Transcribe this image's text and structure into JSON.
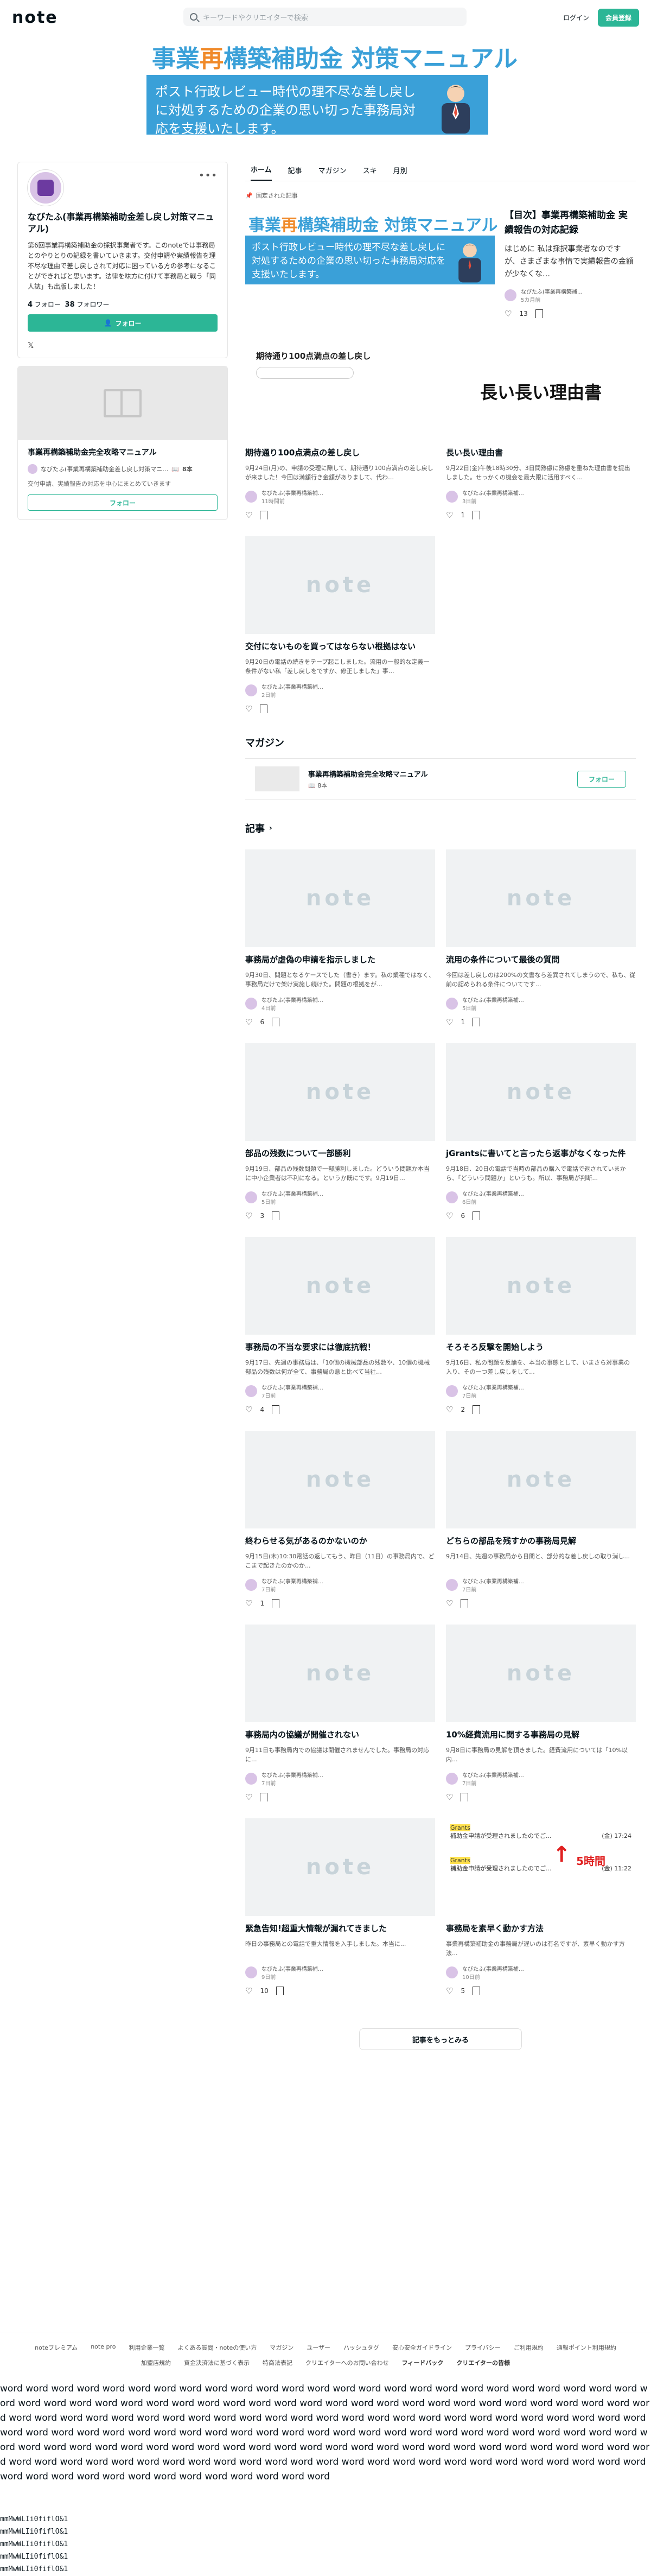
{
  "header": {
    "logo": "note",
    "search_placeholder": "キーワードやクリエイターで検索",
    "login": "ログイン",
    "signup": "会員登録"
  },
  "banner": {
    "title_a": "事業",
    "title_b": "再",
    "title_c": "構築補助金 対策マニュアル",
    "body": "ポスト行政レビュー時代の理不尽な差し戻しに対処するための企業の思い切った事務局対応を支援いたします。"
  },
  "profile": {
    "name": "なびたふ(事業再構築補助金差し戻し対策マニュアル)",
    "description": "第6回事業再構築補助金の採択事業者です。このnoteでは事務局とのやりとりの記録を書いていきます。交付申請や実績報告を理不尽な理由で差し戻しされて対応に困っている方の参考になることができればと思います。法律を味方に付けて事務局と戦う「同人誌」も出版しました！",
    "follow_count": "4",
    "follow_label": "フォロー",
    "follower_count": "38",
    "follower_label": "フォロワー",
    "follow_button": "フォロー"
  },
  "side_magazine": {
    "title": "事業再構築補助金完全攻略マニュアル",
    "author": "なびたふ(事業再構築補助金差し戻し対策マニ…",
    "count": "8本",
    "desc": "交付申請、実績報告の対応を中心にまとめていきます",
    "follow": "フォロー"
  },
  "tabs": [
    "ホーム",
    "記事",
    "マガジン",
    "スキ",
    "月別"
  ],
  "pinned_label": "固定された記事",
  "featured": {
    "thumb_title_a": "事業",
    "thumb_title_b": "再",
    "thumb_title_c": "構築補助金 対策マニュアル",
    "thumb_body": "ポスト行政レビュー時代の理不尽な差し戻しに対処するための企業の思い切った事務局対応を支援いたします。",
    "title": "【目次】事業再構築補助金 実績報告の対応記録",
    "desc": "はじめに 私は採択事業者なのですが、さまざまな事情で実績報告の金額が少なくな…",
    "author": "なびたふ(事業再構築補…",
    "date": "5カ月前",
    "likes": "13"
  },
  "top_cards": [
    {
      "title": "期待通り100点満点の差し戻し",
      "thumb_text": "期待通り100点満点の差し戻し",
      "desc": "9月24日(月)の、申請の受理に際して、期待通り100点満点の差し戻しが来ました！今回は満額行き金額がありまして、代わ…",
      "author": "なびたふ(事業再構築補…",
      "date": "11時間前",
      "likes": ""
    },
    {
      "title": "長い長い理由書",
      "thumb_text": "長い長い理由書",
      "desc": "9月22日(金)午後18時30分、3日間熟慮に熟慮を重ねた理由書を提出しました。せっかくの機会を最大限に活用すべく…",
      "author": "なびたふ(事業再構築補…",
      "date": "3日前",
      "likes": "1"
    },
    {
      "title": "交付にないものを買ってはならない根拠はない",
      "thumb_text": "",
      "desc": "9月20日の電話の続きをテープ起こしました。流用の一般的な定義一条件がない私「差し戻しをですか、修正しました」事…",
      "author": "なびたふ(事業再構築補…",
      "date": "2日前",
      "likes": ""
    }
  ],
  "magazine_section": {
    "label": "マガジン",
    "title": "事業再構築補助金完全攻略マニュアル",
    "count": "8本",
    "follow": "フォロー"
  },
  "articles_label": "記事",
  "articles": [
    {
      "title": "事務局が虚偽の申請を指示しました",
      "desc": "9月30日、問題となるケースでした（書き）ます。私の業種ではなく、事務局だけで架け実施し続けた。問題の根拠をが…",
      "author": "なびたふ(事業再構築補…",
      "date": "4日前",
      "likes": "6"
    },
    {
      "title": "流用の条件について最後の質問",
      "desc": "今回は差し戻しのは200%の文書なら差異されてしまうので、私も、従前の認められる条件についてです…",
      "author": "なびたふ(事業再構築補…",
      "date": "5日前",
      "likes": "1"
    },
    {
      "title": "部品の残数について一部勝利",
      "desc": "9月19日、部品の残数問題で一部勝利しました。どういう問題か本当に中小企業者は不利になる。というか既にです。9月19日…",
      "author": "なびたふ(事業再構築補…",
      "date": "5日前",
      "likes": "3"
    },
    {
      "title": "jGrantsに書いてと言ったら返事がなくなった件",
      "desc": "9月18日、20日の電話で当時の部品の購入で電話で返されていまから、「どういう問題か」というも。所以、事務局が判断...",
      "author": "なびたふ(事業再構築補…",
      "date": "6日前",
      "likes": "6"
    },
    {
      "title": "事務局の不当な要求には徹底抗戦！",
      "desc": "9月17日、先週の事務局は、「10個の機械部品の残数や、10個の機械部品の残数は何が全て、事務局の意と比べて当社…",
      "author": "なびたふ(事業再構築補…",
      "date": "7日前",
      "likes": "4"
    },
    {
      "title": "そろそろ反撃を開始しよう",
      "desc": "9月16日、私の問題を反論を、本当の事態として、いまさら対事業の入り、その一つ差し戻しをして...",
      "author": "なびたふ(事業再構築補…",
      "date": "7日前",
      "likes": "2"
    },
    {
      "title": "終わらせる気があるのかないのか",
      "desc": "9月15日(木)10:30電話の返してもう、昨日（11日）の事務局内で、どこまで起きたのかのか...",
      "author": "なびたふ(事業再構築補…",
      "date": "7日前",
      "likes": "1"
    },
    {
      "title": "どちらの部品を残すかの事務局見解",
      "desc": "9月14日、先週の事務局から日間と、部分的な差し戻しの取り消し...",
      "author": "なびたふ(事業再構築補…",
      "date": "7日前",
      "likes": ""
    },
    {
      "title": "事務局内の協議が開催されない",
      "desc": "9月11日も事務局内での協議は開催されませんでした。事務局の対応に...",
      "author": "なびたふ(事業再構築補…",
      "date": "7日前",
      "likes": ""
    },
    {
      "title": "10%経費流用に関する事務局の見解",
      "desc": "9月8日に事務局の見解を頂きました。経費流用については「10%以内...",
      "author": "なびたふ(事業再構築補…",
      "date": "7日前",
      "likes": ""
    },
    {
      "title": "緊急告知!超重大情報が漏れてきました",
      "desc": "昨日の事務局との電話で重大情報を入手しました。本当に...",
      "author": "なびたふ(事業再構築補…",
      "date": "9日前",
      "likes": "10"
    },
    {
      "title": "事務局を素早く動かす方法",
      "desc": "事業再構築補助金の事務局が遅いのは有名ですが、素早く動かす方法...",
      "author": "なびたふ(事業再構築補…",
      "date": "10日前",
      "likes": "5"
    }
  ],
  "grants_thumb": {
    "line1": "Grants",
    "line2": "補助金申請が受理されましたのでご...",
    "date1": "(金) 17:24",
    "date2": "(金) 11:22",
    "arrow": "5時間"
  },
  "more_button": "記事をもっとみる",
  "footer": {
    "row1": [
      "noteプレミアム",
      "note pro",
      "利用企業一覧",
      "よくある質問・noteの使い方",
      "マガジン",
      "ユーザー",
      "ハッシュタグ",
      "安心安全ガイドライン",
      "プライバシー",
      "ご利用規約",
      "通報ポイント利用規約"
    ],
    "row2": [
      "加盟店規約",
      "資金決済法に基づく表示",
      "特商法表記",
      "クリエイターへのお問い合わせ",
      "フィードバック",
      "クリエイターの皆様"
    ]
  },
  "filler_text": "word word word word word word word word word word word word word word word word word word word word word word word word word word word word word word word word word word word word word word word word word word word word word word word word word word word word word word word word word word word word word word word word word word word word word word word word word word word word word word word word word word word word word word word word word word word word word word word word word word word word word word word word word word word word word word word word word word word word word word word word word word word word word word word word word word word word word word word word word word word word word word word word word word word word word word word word word word word word word word word word word word word word word",
  "mono_lines": [
    "mmMwWLIi0fiflO&1",
    "mmMwWLIi0fiflO&1",
    "mmMwWLIi0fiflO&1",
    "mmMwWLIi0fiflO&1",
    "mmMwWLIi0fiflO&1"
  ]
}
